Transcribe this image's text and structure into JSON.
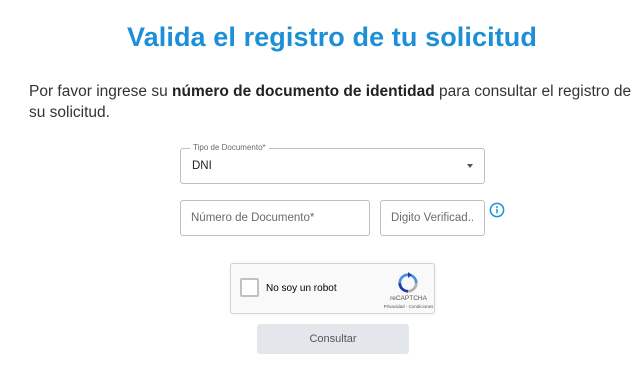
{
  "page": {
    "title": "Valida el registro de tu solicitud",
    "intro_prefix": "Por favor ingrese su ",
    "intro_bold": "número de documento de identidad",
    "intro_suffix": " para consultar el registro de su solicitud."
  },
  "form": {
    "document_type_label": "Tipo de Documento*",
    "document_type_value": "DNI",
    "document_number_placeholder": "Número de Documento*",
    "verification_digit_placeholder": "Digito Verificad..."
  },
  "captcha": {
    "label": "No soy un robot",
    "brand": "reCAPTCHA",
    "links": "Privacidad - Condiciones"
  },
  "actions": {
    "submit_label": "Consultar"
  },
  "colors": {
    "title": "#1c8fd6",
    "info_icon": "#1c8fd6",
    "submit_bg": "#e3e6ea"
  },
  "icons": {
    "info": "info-circle-icon",
    "dropdown": "caret-down-icon",
    "captcha_logo": "recaptcha-logo-icon"
  }
}
